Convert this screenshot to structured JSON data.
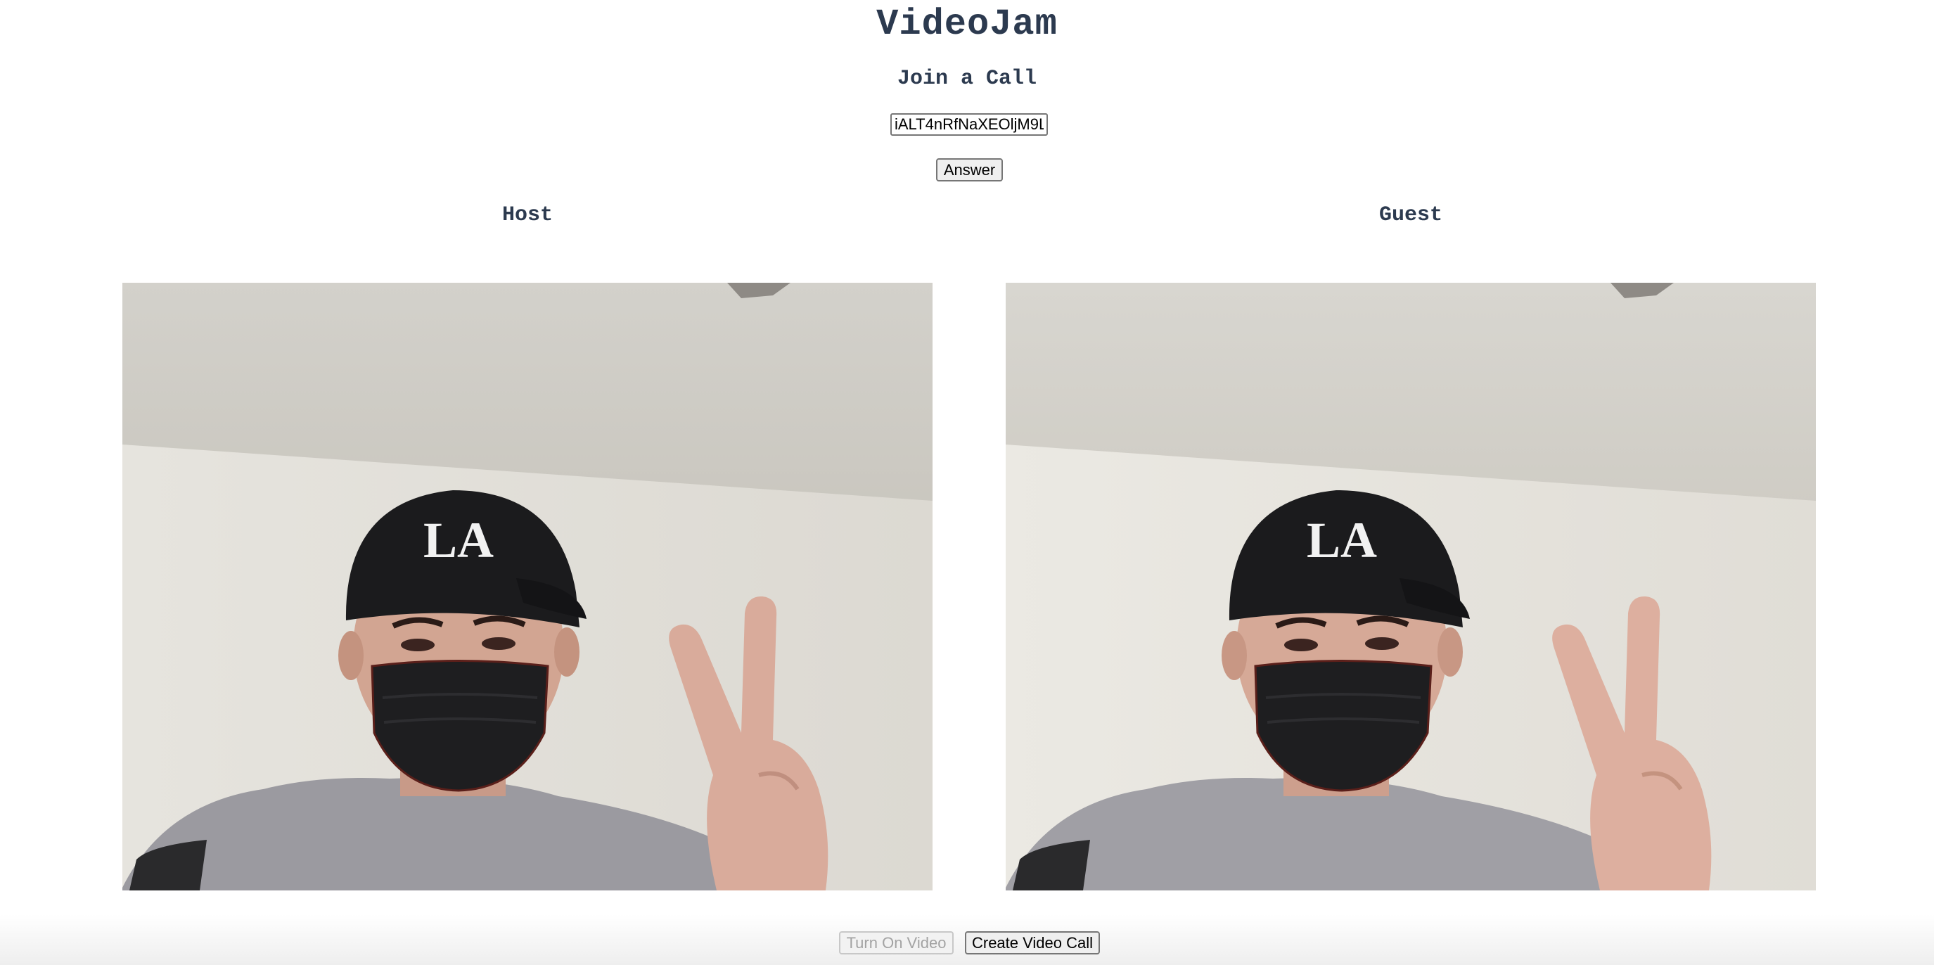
{
  "app": {
    "title": "VideoJam"
  },
  "join": {
    "heading": "Join a Call",
    "call_id_value": "iALT4nRfNaXEOljM9L",
    "answer_label": "Answer"
  },
  "videos": {
    "host_label": "Host",
    "guest_label": "Guest",
    "cap_logo_text": "LA"
  },
  "controls": {
    "turn_on_video_label": "Turn On Video",
    "turn_on_video_disabled": true,
    "create_call_label": "Create Video Call"
  },
  "colors": {
    "heading": "#2c3a4f",
    "background": "#ffffff"
  }
}
